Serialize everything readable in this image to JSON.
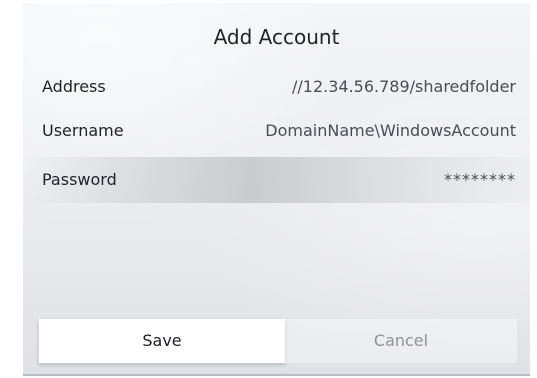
{
  "dialog": {
    "title": "Add Account",
    "fields": {
      "address": {
        "label": "Address",
        "value": "//12.34.56.789/sharedfolder"
      },
      "username": {
        "label": "Username",
        "value": "DomainName\\WindowsAccount"
      },
      "password": {
        "label": "Password",
        "value": "********"
      }
    },
    "buttons": {
      "save_label": "Save",
      "cancel_label": "Cancel"
    },
    "focused_field": "password"
  }
}
